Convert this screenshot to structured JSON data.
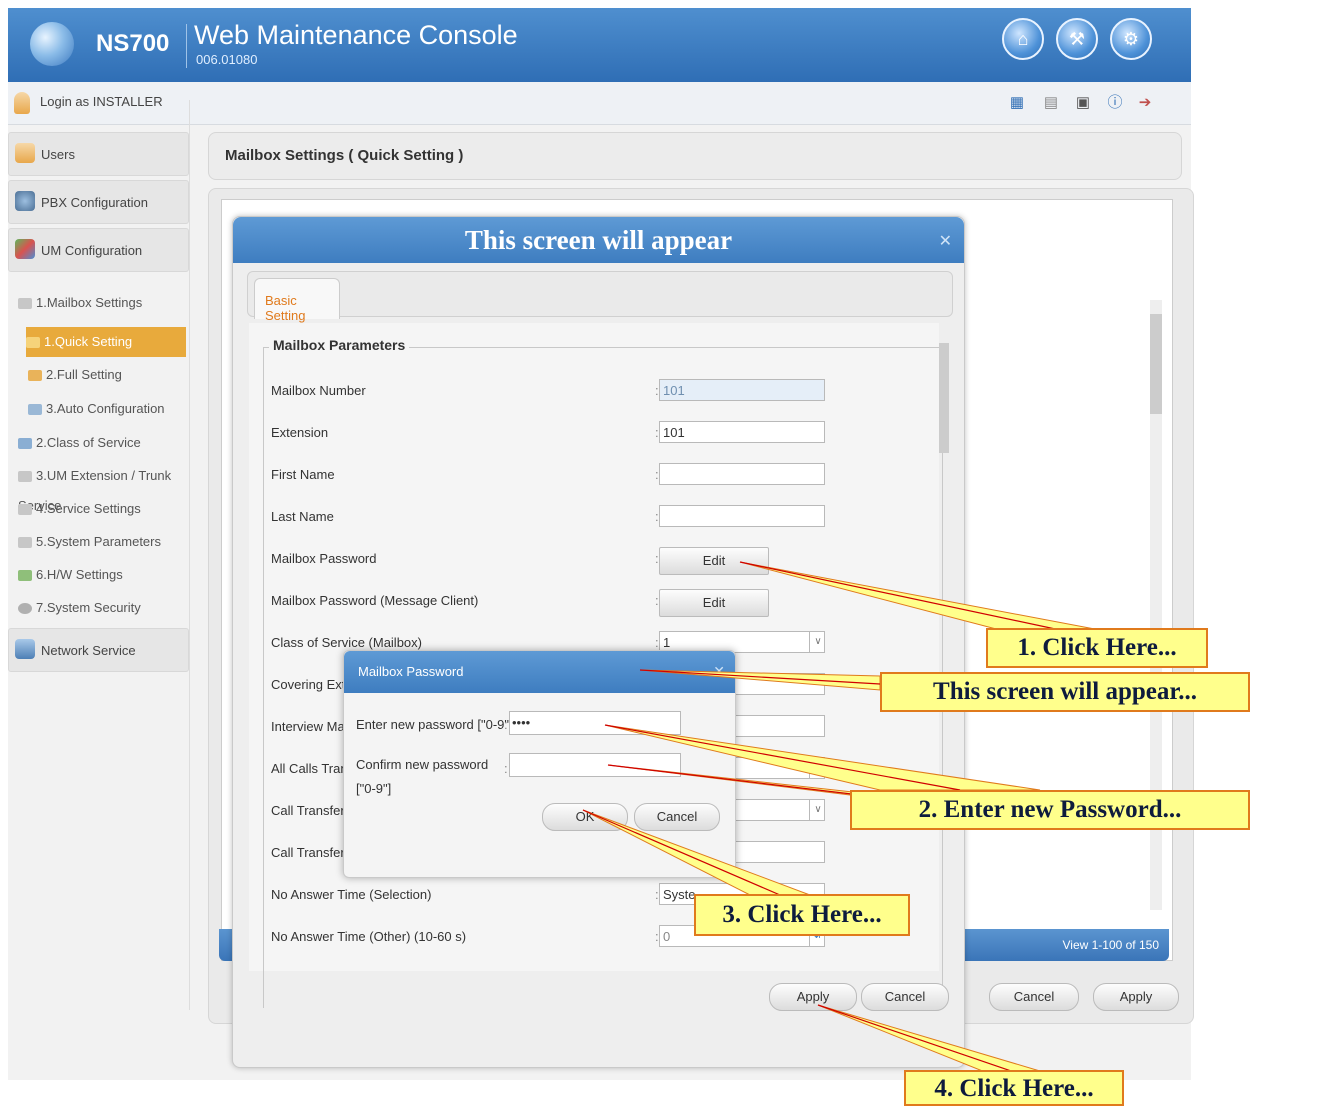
{
  "header": {
    "product": "NS700",
    "title": "Web Maintenance Console",
    "version": "006.01080",
    "buttons": [
      "home-icon",
      "wrench-icon",
      "gear-icon"
    ]
  },
  "subbar": {
    "login_text": "Login as INSTALLER",
    "tools": [
      "calendar-icon",
      "network-icon",
      "save-icon",
      "info-icon",
      "logout-icon"
    ]
  },
  "sidebar": {
    "main_items": [
      {
        "label": "Users",
        "icon": "user-icon"
      },
      {
        "label": "PBX Configuration",
        "icon": "pbx-icon"
      },
      {
        "label": "UM Configuration",
        "icon": "um-icon"
      },
      {
        "label": "Network Service",
        "icon": "network-service-icon"
      }
    ],
    "tree": [
      {
        "label": "1.Mailbox Settings"
      },
      {
        "label": "1.Quick Setting"
      },
      {
        "label": "2.Full Setting"
      },
      {
        "label": "3.Auto Configuration"
      },
      {
        "label": "2.Class of Service"
      },
      {
        "label": "3.UM Extension / Trunk Service"
      },
      {
        "label": "4.Service Settings"
      },
      {
        "label": "5.System Parameters"
      },
      {
        "label": "6.H/W Settings"
      },
      {
        "label": "7.System Security"
      }
    ]
  },
  "main": {
    "page_title": "Mailbox Settings ( Quick Setting )",
    "view_range": "View 1-100 of 150",
    "buttons": {
      "cancel": "Cancel",
      "apply": "Apply"
    }
  },
  "dialog1": {
    "title": "This screen will appear",
    "tab": "Basic Setting",
    "legend": "Mailbox Parameters",
    "fields": [
      {
        "label": "Mailbox Number",
        "value": "101"
      },
      {
        "label": "Extension",
        "value": "101"
      },
      {
        "label": "First Name",
        "value": ""
      },
      {
        "label": "Last Name",
        "value": ""
      },
      {
        "label": "Mailbox Password",
        "button": "Edit"
      },
      {
        "label": "Mailbox Password (Message Client)",
        "button": "Edit"
      },
      {
        "label": "Class of Service (Mailbox)",
        "value": "1"
      },
      {
        "label": "Covering Exte",
        "value": ""
      },
      {
        "label": "Interview Mail",
        "value": ""
      },
      {
        "label": "All Calls Trans",
        "value": ""
      },
      {
        "label": "Call Transfer S",
        "value": ""
      },
      {
        "label": "Call Transfer S",
        "value": ""
      },
      {
        "label": "No Answer Time (Selection)",
        "value": "Syste"
      },
      {
        "label": "No Answer Time (Other) (10-60 s)",
        "value": "0"
      }
    ],
    "apply": "Apply",
    "cancel": "Cancel"
  },
  "dialog2": {
    "title": "Mailbox Password",
    "new_password_label": "Enter new password [\"0-9\"]",
    "new_password_value": "••••",
    "confirm_label_1": "Confirm new password",
    "confirm_label_2": "[\"0-9\"]",
    "confirm_value": "",
    "ok": "OK",
    "cancel": "Cancel"
  },
  "callouts": {
    "c1": "1. Click Here...",
    "c2": "This screen will appear...",
    "c3": "2. Enter new Password...",
    "c4": "3. Click Here...",
    "c5": "4. Click Here..."
  }
}
